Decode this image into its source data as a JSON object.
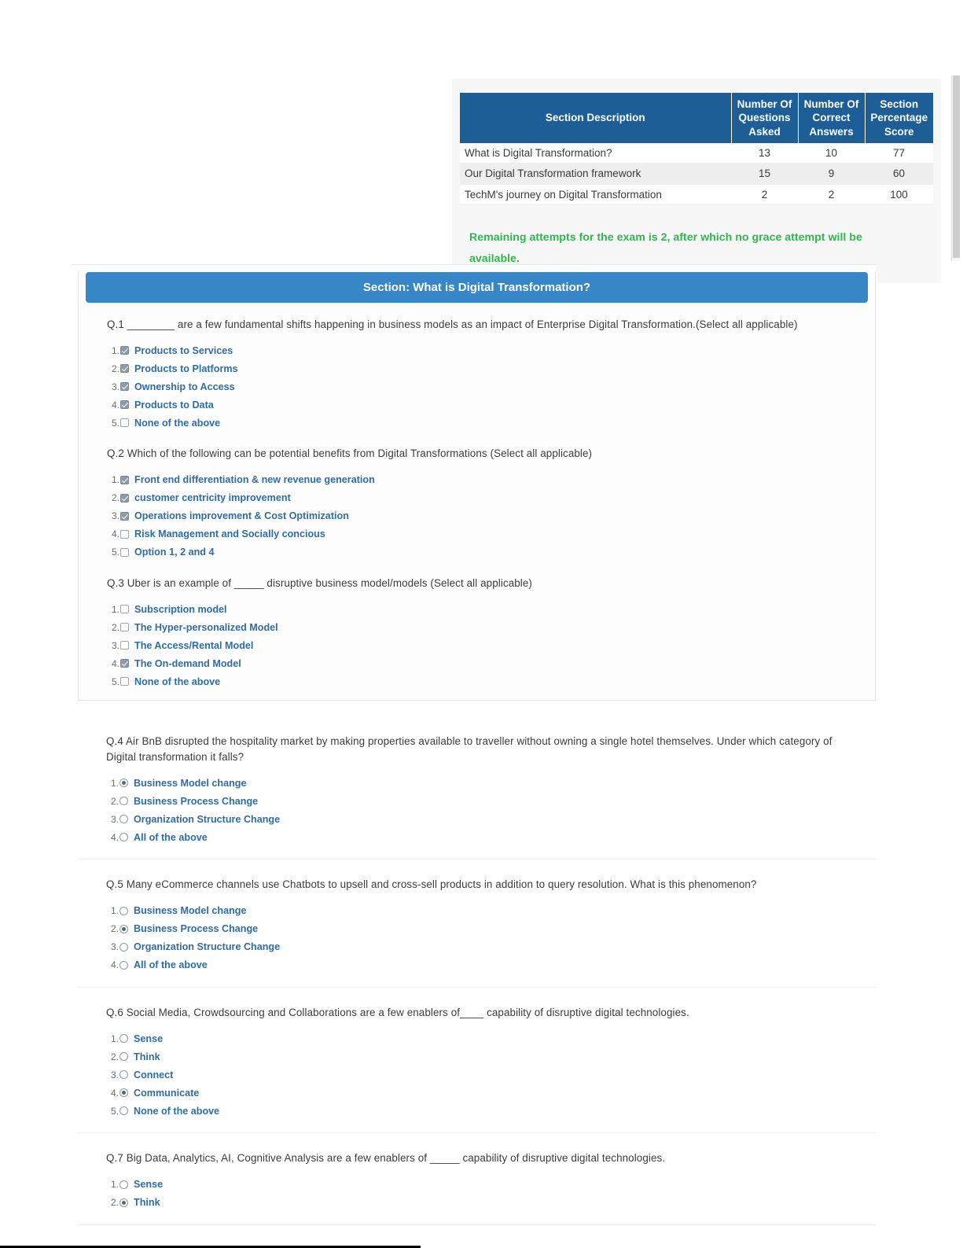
{
  "summary": {
    "columns": [
      "Section Description",
      "Number Of Questions Asked",
      "Number Of Correct Answers",
      "Section Percentage Score"
    ],
    "columns_display": {
      "desc": "Section Description",
      "asked_l1": "Number Of",
      "asked_l2": "Questions",
      "asked_l3": "Asked",
      "correct_l1": "Number Of",
      "correct_l2": "Correct",
      "correct_l3": "Answers",
      "score_l1": "Section",
      "score_l2": "Percentage",
      "score_l3": "Score"
    },
    "rows": [
      {
        "description": "What is Digital Transformation?",
        "asked": "13",
        "correct": "10",
        "score": "77"
      },
      {
        "description": "Our Digital Transformation framework",
        "asked": "15",
        "correct": "9",
        "score": "60"
      },
      {
        "description": "TechM's journey on Digital Transformation",
        "asked": "2",
        "correct": "2",
        "score": "100"
      }
    ],
    "notice": "Remaining attempts for the exam is 2, after which no grace attempt will be available.",
    "notice_color": "#2db84d",
    "header_color": "#1c5e95"
  },
  "section": {
    "title": "Section: What is Digital Transformation?",
    "header_color": "#3686c8"
  },
  "questions": [
    {
      "id": "q1",
      "number": "Q.1",
      "text": "Q.1 ________ are a few fundamental shifts happening in business models as an impact of Enterprise Digital Transformation.(Select all applicable)",
      "input_type": "checkbox",
      "options": [
        {
          "num": "1.",
          "label": "Products to Services",
          "selected": true
        },
        {
          "num": "2.",
          "label": "Products to Platforms",
          "selected": true
        },
        {
          "num": "3.",
          "label": "Ownership to Access",
          "selected": true
        },
        {
          "num": "4.",
          "label": "Products to Data",
          "selected": true
        },
        {
          "num": "5.",
          "label": "None of the above",
          "selected": false
        }
      ]
    },
    {
      "id": "q2",
      "number": "Q.2",
      "text": "Q.2 Which of the following can be potential benefits from Digital Transformations (Select all applicable)",
      "input_type": "checkbox",
      "options": [
        {
          "num": "1.",
          "label": "Front end differentiation & new revenue generation",
          "selected": true
        },
        {
          "num": "2.",
          "label": "customer centricity improvement",
          "selected": true
        },
        {
          "num": "3.",
          "label": "Operations improvement & Cost Optimization",
          "selected": true
        },
        {
          "num": "4.",
          "label": "Risk Management and Socially concious",
          "selected": false
        },
        {
          "num": "5.",
          "label": "Option 1, 2 and 4",
          "selected": false
        }
      ]
    },
    {
      "id": "q3",
      "number": "Q.3",
      "text": "Q.3 Uber is an example of _____ disruptive business model/models (Select all applicable)",
      "input_type": "checkbox",
      "options": [
        {
          "num": "1.",
          "label": "Subscription model",
          "selected": false
        },
        {
          "num": "2.",
          "label": "The Hyper-personalized Model",
          "selected": false
        },
        {
          "num": "3.",
          "label": "The Access/Rental Model",
          "selected": false
        },
        {
          "num": "4.",
          "label": "The On-demand Model",
          "selected": true
        },
        {
          "num": "5.",
          "label": "None of the above",
          "selected": false
        }
      ]
    },
    {
      "id": "q4",
      "number": "Q.4",
      "text": "Q.4 Air BnB disrupted the hospitality market by making properties available to traveller without owning a single hotel themselves. Under which category of Digital transformation it falls?",
      "input_type": "radio",
      "options": [
        {
          "num": "1.",
          "label": "Business Model change",
          "selected": true
        },
        {
          "num": "2.",
          "label": "Business Process Change",
          "selected": false
        },
        {
          "num": "3.",
          "label": "Organization Structure Change",
          "selected": false
        },
        {
          "num": "4.",
          "label": "All of the above",
          "selected": false
        }
      ]
    },
    {
      "id": "q5",
      "number": "Q.5",
      "text": "Q.5 Many eCommerce channels use Chatbots to upsell and cross-sell products in addition to query resolution. What is this phenomenon?",
      "input_type": "radio",
      "options": [
        {
          "num": "1.",
          "label": "Business Model change",
          "selected": false
        },
        {
          "num": "2.",
          "label": "Business Process Change",
          "selected": true
        },
        {
          "num": "3.",
          "label": "Organization Structure Change",
          "selected": false
        },
        {
          "num": "4.",
          "label": "All of the above",
          "selected": false
        }
      ]
    },
    {
      "id": "q6",
      "number": "Q.6",
      "text": "Q.6 Social Media, Crowdsourcing and Collaborations are a few enablers of____ capability of disruptive digital technologies.",
      "input_type": "radio",
      "options": [
        {
          "num": "1.",
          "label": "Sense",
          "selected": false
        },
        {
          "num": "2.",
          "label": "Think",
          "selected": false
        },
        {
          "num": "3.",
          "label": "Connect",
          "selected": false
        },
        {
          "num": "4.",
          "label": "Communicate",
          "selected": true
        },
        {
          "num": "5.",
          "label": "None of the above",
          "selected": false
        }
      ]
    },
    {
      "id": "q7",
      "number": "Q.7",
      "text": "Q.7 Big Data, Analytics, AI, Cognitive Analysis are a few enablers of _____ capability of disruptive digital technologies.",
      "input_type": "radio",
      "options": [
        {
          "num": "1.",
          "label": "Sense",
          "selected": false
        },
        {
          "num": "2.",
          "label": "Think",
          "selected": true
        }
      ]
    }
  ]
}
